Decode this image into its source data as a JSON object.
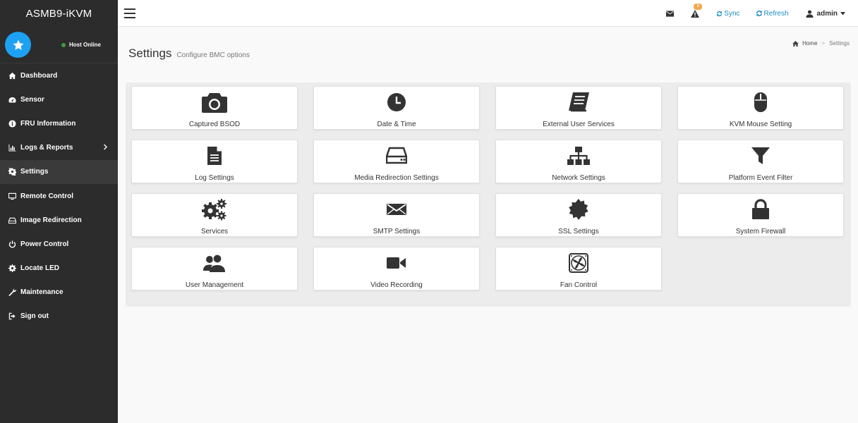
{
  "brand": "ASMB9-iKVM",
  "host_status": "Host Online",
  "sidebar": {
    "items": [
      {
        "label": "Dashboard",
        "icon": "dashboard-icon"
      },
      {
        "label": "Sensor",
        "icon": "tachometer-icon"
      },
      {
        "label": "FRU Information",
        "icon": "info-icon"
      },
      {
        "label": "Logs & Reports",
        "icon": "bar-chart-icon"
      },
      {
        "label": "Settings",
        "icon": "gear-icon"
      },
      {
        "label": "Remote Control",
        "icon": "monitor-icon"
      },
      {
        "label": "Image Redirection",
        "icon": "drive-icon"
      },
      {
        "label": "Power Control",
        "icon": "power-icon"
      },
      {
        "label": "Locate LED",
        "icon": "gear-icon"
      },
      {
        "label": "Maintenance",
        "icon": "wrench-icon"
      },
      {
        "label": "Sign out",
        "icon": "sign-out-icon"
      }
    ]
  },
  "topbar": {
    "alert_count": "8",
    "sync": "Sync",
    "refresh": "Refresh",
    "user": "admin"
  },
  "page": {
    "title": "Settings",
    "subtitle": "Configure BMC options"
  },
  "breadcrumb": {
    "home": "Home",
    "current": "Settings"
  },
  "tiles": [
    {
      "label": "Captured BSOD",
      "icon": "camera-icon"
    },
    {
      "label": "Date & Time",
      "icon": "clock-icon"
    },
    {
      "label": "External User Services",
      "icon": "book-icon"
    },
    {
      "label": "KVM Mouse Setting",
      "icon": "mouse-icon"
    },
    {
      "label": "Log Settings",
      "icon": "file-text-icon"
    },
    {
      "label": "Media Redirection Settings",
      "icon": "hdd-icon"
    },
    {
      "label": "Network Settings",
      "icon": "sitemap-icon"
    },
    {
      "label": "Platform Event Filter",
      "icon": "filter-icon"
    },
    {
      "label": "Services",
      "icon": "gears-icon"
    },
    {
      "label": "SMTP Settings",
      "icon": "envelope-icon"
    },
    {
      "label": "SSL Settings",
      "icon": "certificate-icon"
    },
    {
      "label": "System Firewall",
      "icon": "lock-icon"
    },
    {
      "label": "User Management",
      "icon": "users-icon"
    },
    {
      "label": "Video Recording",
      "icon": "video-camera-icon"
    },
    {
      "label": "Fan Control",
      "icon": "fan-icon"
    }
  ],
  "colors": {
    "sidebar_bg": "#2c2c2c",
    "accent": "#1e8bc3",
    "avatar": "#1da1f2",
    "badge": "#f0a94c",
    "online": "#3c9a3c"
  }
}
